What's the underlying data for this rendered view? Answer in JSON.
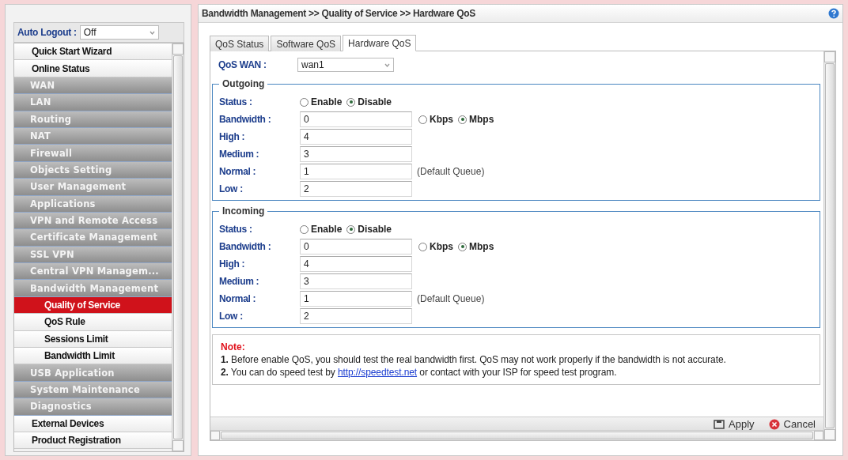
{
  "sidebar": {
    "auto_logout": {
      "label": "Auto Logout :",
      "value": "Off"
    },
    "items": [
      {
        "label": "Quick Start Wizard",
        "kind": "link",
        "selected": false
      },
      {
        "label": "Online Status",
        "kind": "link",
        "selected": false
      },
      {
        "label": "WAN",
        "kind": "section",
        "selected": false
      },
      {
        "label": "LAN",
        "kind": "section",
        "selected": false
      },
      {
        "label": "Routing",
        "kind": "section",
        "selected": false
      },
      {
        "label": "NAT",
        "kind": "section",
        "selected": false
      },
      {
        "label": "Firewall",
        "kind": "section",
        "selected": false
      },
      {
        "label": "Objects Setting",
        "kind": "section",
        "selected": false
      },
      {
        "label": "User Management",
        "kind": "section",
        "selected": false
      },
      {
        "label": "Applications",
        "kind": "section",
        "selected": false
      },
      {
        "label": "VPN and Remote Access",
        "kind": "section",
        "selected": false
      },
      {
        "label": "Certificate Management",
        "kind": "section",
        "selected": false
      },
      {
        "label": "SSL VPN",
        "kind": "section",
        "selected": false
      },
      {
        "label": "Central VPN Managem...",
        "kind": "section",
        "selected": false
      },
      {
        "label": "Bandwidth Management",
        "kind": "section",
        "selected": false
      },
      {
        "label": "Quality of Service",
        "kind": "sub",
        "selected": true
      },
      {
        "label": "QoS Rule",
        "kind": "sub",
        "selected": false
      },
      {
        "label": "Sessions Limit",
        "kind": "sub",
        "selected": false
      },
      {
        "label": "Bandwidth Limit",
        "kind": "sub",
        "selected": false
      },
      {
        "label": "USB Application",
        "kind": "section",
        "selected": false
      },
      {
        "label": "System Maintenance",
        "kind": "section",
        "selected": false
      },
      {
        "label": "Diagnostics",
        "kind": "section",
        "selected": false
      },
      {
        "label": "External Devices",
        "kind": "link",
        "selected": false
      },
      {
        "label": "Product Registration",
        "kind": "link",
        "selected": false
      }
    ]
  },
  "breadcrumb": "Bandwidth Management >> Quality of Service >> Hardware QoS",
  "tabs": [
    {
      "label": "QoS Status",
      "selected": false
    },
    {
      "label": "Software QoS",
      "selected": false
    },
    {
      "label": "Hardware QoS",
      "selected": true
    }
  ],
  "qos_wan": {
    "label": "QoS WAN :",
    "value": "wan1"
  },
  "sections": [
    {
      "title": "Outgoing",
      "status": {
        "label": "Status :",
        "options": [
          {
            "label": "Enable",
            "selected": false
          },
          {
            "label": "Disable",
            "selected": true
          }
        ]
      },
      "bandwidth": {
        "label": "Bandwidth :",
        "value": "0",
        "units": [
          {
            "label": "Kbps",
            "selected": false
          },
          {
            "label": "Mbps",
            "selected": true
          }
        ]
      },
      "queues": [
        {
          "label": "High :",
          "value": "4"
        },
        {
          "label": "Medium :",
          "value": "3"
        },
        {
          "label": "Normal :",
          "value": "1",
          "note": "(Default Queue)"
        },
        {
          "label": "Low :",
          "value": "2"
        }
      ]
    },
    {
      "title": "Incoming",
      "status": {
        "label": "Status :",
        "options": [
          {
            "label": "Enable",
            "selected": false
          },
          {
            "label": "Disable",
            "selected": true
          }
        ]
      },
      "bandwidth": {
        "label": "Bandwidth :",
        "value": "0",
        "units": [
          {
            "label": "Kbps",
            "selected": false
          },
          {
            "label": "Mbps",
            "selected": true
          }
        ]
      },
      "queues": [
        {
          "label": "High :",
          "value": "4"
        },
        {
          "label": "Medium :",
          "value": "3"
        },
        {
          "label": "Normal :",
          "value": "1",
          "note": "(Default Queue)"
        },
        {
          "label": "Low :",
          "value": "2"
        }
      ]
    }
  ],
  "note": {
    "title": "Note:",
    "lines": [
      {
        "text": "**1.** Before enable QoS, you should test the real bandwidth first. QoS may not work properly if the bandwidth is not accurate."
      },
      {
        "text": "**2.** You can do speed test by",
        "link": "http://speedtest.net",
        "after": "or contact with your ISP for speed test program."
      }
    ]
  },
  "buttons": [
    {
      "label": "Apply",
      "kind": "save"
    },
    {
      "label": "Cancel",
      "kind": "cancel"
    }
  ]
}
